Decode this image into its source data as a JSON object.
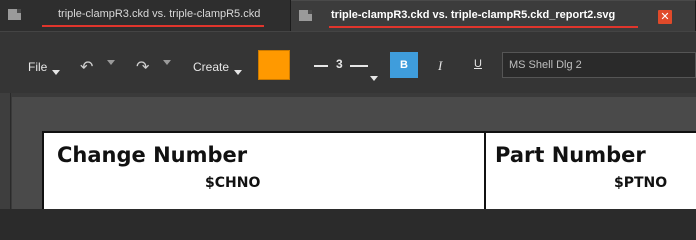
{
  "tabs": [
    {
      "label": "triple-clampR3.ckd vs. triple-clampR5.ckd",
      "icon": "document-icon"
    },
    {
      "label": "triple-clampR3.ckd vs. triple-clampR5.ckd_report2.svg",
      "icon": "document-icon",
      "close_glyph": "✕"
    }
  ],
  "toolbar": {
    "file_label": "File",
    "undo_glyph": "↶",
    "redo_glyph": "↷",
    "create_label": "Create",
    "fill_color": "#ff9900",
    "stroke_width": "3",
    "bold_label": "B",
    "italic_label": "I",
    "underline_label": "U",
    "font_name": "MS Shell Dlg 2"
  },
  "document": {
    "cells": [
      {
        "title": "Change Number",
        "value": "$CHNO"
      },
      {
        "title": "Part Number",
        "value": "$PTNO"
      }
    ]
  },
  "colors": {
    "accent_underline": "#e0352c",
    "close_button": "#e04a2a",
    "bold_active": "#3f9ddc"
  }
}
